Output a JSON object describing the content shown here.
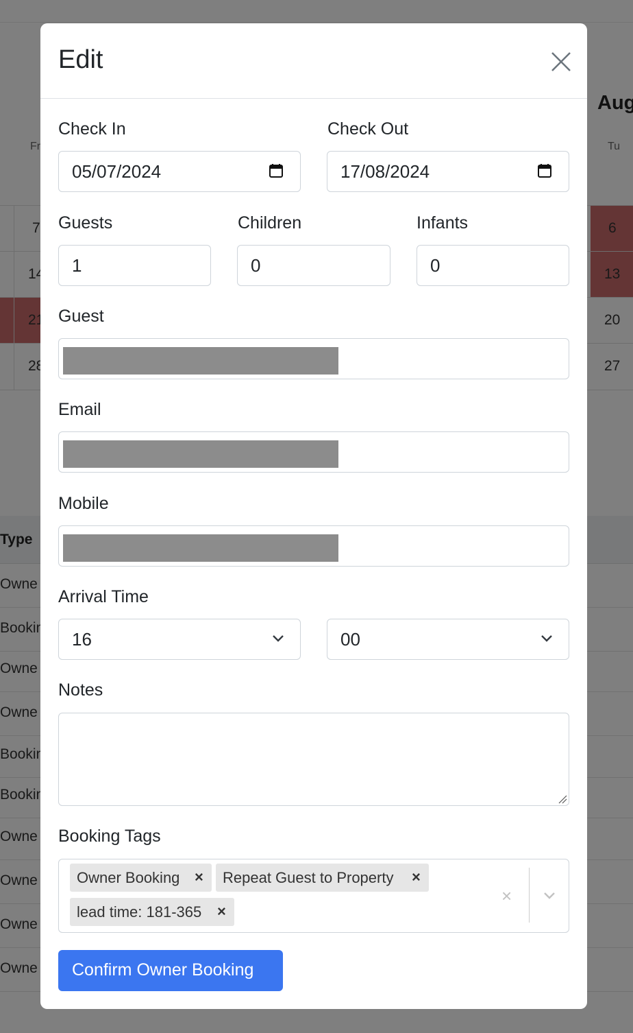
{
  "background": {
    "month_label": "Aug",
    "day_headers": {
      "left": "Fr",
      "right": "Tu"
    },
    "calendar_left_cells": [
      "7",
      "14",
      "21",
      "28"
    ],
    "calendar_right_cells": [
      "6",
      "13",
      "20",
      "27"
    ],
    "table_header": "Type",
    "table_rows": [
      "Owne",
      "Bookin",
      "Owne",
      "Owne",
      "Bookin",
      "Bookin",
      "Owne",
      "Owne",
      "Owne",
      "Owne"
    ]
  },
  "modal": {
    "title": "Edit",
    "check_in": {
      "label": "Check In",
      "value": "05/07/2024"
    },
    "check_out": {
      "label": "Check Out",
      "value": "17/08/2024"
    },
    "guests": {
      "label": "Guests",
      "value": "1"
    },
    "children": {
      "label": "Children",
      "value": "0"
    },
    "infants": {
      "label": "Infants",
      "value": "0"
    },
    "guest": {
      "label": "Guest"
    },
    "email": {
      "label": "Email"
    },
    "mobile": {
      "label": "Mobile"
    },
    "arrival_time": {
      "label": "Arrival Time",
      "hour": "16",
      "minute": "00"
    },
    "notes": {
      "label": "Notes",
      "value": ""
    },
    "booking_tags": {
      "label": "Booking Tags",
      "tags": [
        "Owner Booking",
        "Repeat Guest to Property",
        "lead time: 181-365"
      ],
      "remove_glyph": "×",
      "clear_glyph": "×"
    },
    "confirm_button": "Confirm Owner Booking"
  },
  "colors": {
    "primary_button": "#3b76f0",
    "booked_cell": "#c96a6a",
    "overlay": "rgba(0,0,0,0.5)"
  }
}
